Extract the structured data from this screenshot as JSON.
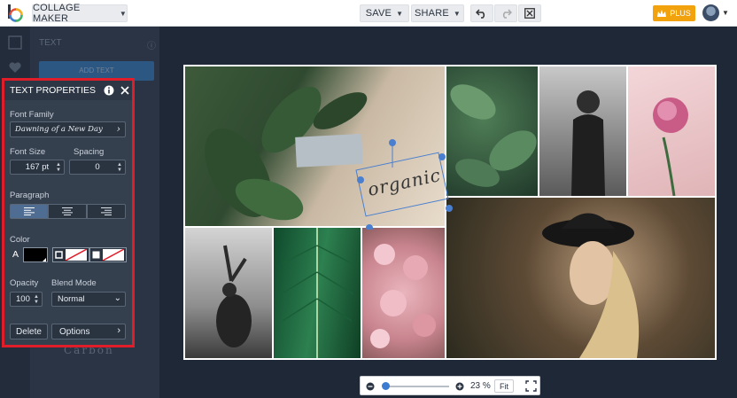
{
  "topbar": {
    "app_menu_label": "COLLAGE MAKER",
    "save_label": "SAVE",
    "share_label": "SHARE",
    "plus_label": "PLUS",
    "icons": [
      "undo-icon",
      "redo-icon",
      "close-icon",
      "crown-icon",
      "avatar"
    ]
  },
  "background_panel": {
    "title": "TEXT",
    "add_text_label": "ADD TEXT",
    "ghost_font_sample": "Carbon"
  },
  "text_properties": {
    "title": "TEXT PROPERTIES",
    "font_family_label": "Font Family",
    "font_family_value": "Dawning of a New Day",
    "font_size_label": "Font Size",
    "font_size_value": "167 pt",
    "spacing_label": "Spacing",
    "spacing_value": "0",
    "paragraph_label": "Paragraph",
    "paragraph_alignments": [
      "left",
      "center",
      "right"
    ],
    "paragraph_selected": "left",
    "color_label": "Color",
    "color_text_glyph": "A",
    "text_color": "#000000",
    "opacity_label": "Opacity",
    "opacity_value": "100",
    "blend_mode_label": "Blend Mode",
    "blend_mode_value": "Normal",
    "delete_label": "Delete",
    "options_label": "Options"
  },
  "canvas": {
    "text_element": "organic",
    "photos": [
      "leaves-on-fabric",
      "green-leaves",
      "woman-bw-field",
      "pink-peony",
      "woman-in-hat",
      "dancer-bw",
      "palm-leaf",
      "pink-blossoms"
    ]
  },
  "zoom": {
    "percent_label": "23 %",
    "fit_label": "Fit",
    "level": 0.05
  },
  "colors": {
    "accent_plus": "#f2a20d",
    "highlight_border": "#e11d2a",
    "panel": "#35404f",
    "selection": "#4a7fd0"
  }
}
